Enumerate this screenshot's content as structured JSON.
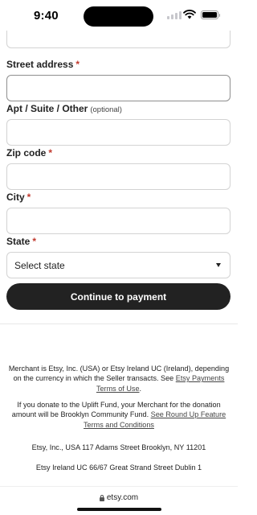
{
  "status_bar": {
    "time": "9:40"
  },
  "form": {
    "required_marker": "*",
    "street": {
      "label": "Street address",
      "value": ""
    },
    "apt": {
      "label": "Apt / Suite / Other",
      "optional": "(optional)",
      "value": ""
    },
    "zip": {
      "label": "Zip code",
      "value": ""
    },
    "city": {
      "label": "City",
      "value": ""
    },
    "state": {
      "label": "State",
      "selected": "Select state"
    }
  },
  "continue_button": {
    "label": "Continue to payment"
  },
  "footer": {
    "merchant_text": "Merchant is Etsy, Inc. (USA) or Etsy Ireland UC (Ireland), depending on the currency in which the Seller transacts. See",
    "merchant_link": "Etsy Payments Terms of Use",
    "donation_text": "If you donate to the Uplift Fund, your Merchant for the donation amount will be Brooklyn Community Fund.",
    "donation_link": "See Round Up Feature Terms and Conditions",
    "period": ".",
    "usa_address": "Etsy, Inc., USA 117 Adams Street Brooklyn, NY 11201",
    "ireland_address": "Etsy Ireland UC 66/67 Great Strand Street Dublin 1"
  },
  "browser": {
    "url": "etsy.com"
  },
  "colors": {
    "required": "#c13a2f",
    "button_bg": "#222222",
    "border": "#d3d3d3"
  },
  "icons": [
    "signal-icon",
    "wifi-icon",
    "battery-icon",
    "chevron-down-icon",
    "lock-icon"
  ]
}
